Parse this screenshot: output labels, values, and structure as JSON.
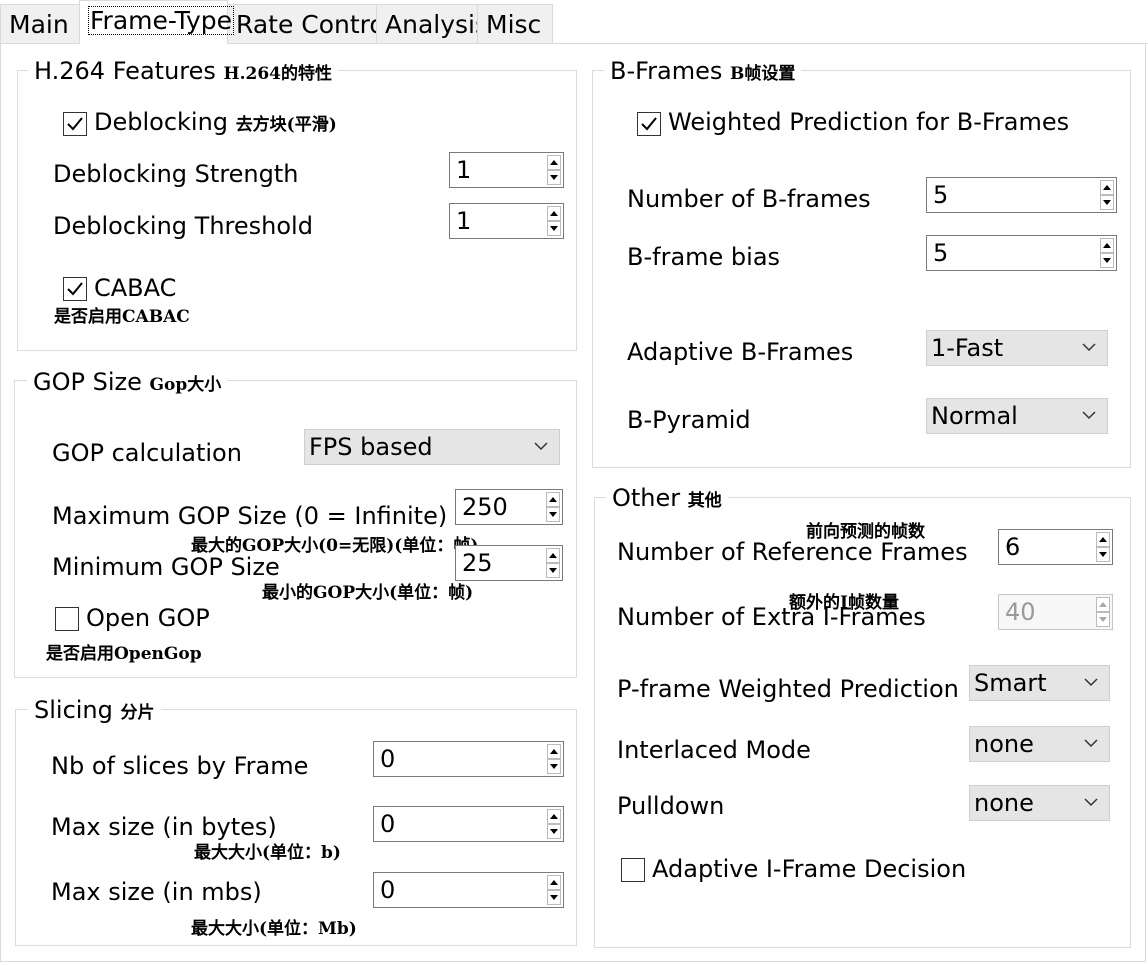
{
  "tabs": [
    {
      "label": "Main"
    },
    {
      "label": "Frame-Type"
    },
    {
      "label": "Rate Control"
    },
    {
      "label": "Analysis"
    },
    {
      "label": "Misc"
    }
  ],
  "h264": {
    "title": "H.264 Features",
    "title_cn": "H.264的特性",
    "deblocking_label": "Deblocking",
    "deblocking_cn": "去方块(平滑)",
    "deblocking_checked": true,
    "strength_label": "Deblocking Strength",
    "strength_value": "1",
    "threshold_label": "Deblocking Threshold",
    "threshold_value": "1",
    "cabac_label": "CABAC",
    "cabac_cn": "是否启用CABAC",
    "cabac_checked": true
  },
  "gop": {
    "title": "GOP Size",
    "title_cn": "Gop大小",
    "calc_label": "GOP calculation",
    "calc_value": "FPS based",
    "max_label": "Maximum GOP Size (0 = Infinite)",
    "max_cn": "最大的GOP大小(0=无限)(单位：帧)",
    "max_value": "250",
    "min_label": "Minimum GOP Size",
    "min_cn": "最小的GOP大小(单位：帧)",
    "min_value": "25",
    "open_label": "Open GOP",
    "open_cn": "是否启用OpenGop",
    "open_checked": false
  },
  "slicing": {
    "title": "Slicing",
    "title_cn": "分片",
    "nb_label": "Nb of slices by Frame",
    "nb_value": "0",
    "bytes_label": "Max size (in bytes)",
    "bytes_cn": "最大大小(单位：b)",
    "bytes_value": "0",
    "mbs_label": "Max size (in mbs)",
    "mbs_cn": "最大大小(单位：Mb)",
    "mbs_value": "0"
  },
  "bframes": {
    "title": "B-Frames",
    "title_cn": "B帧设置",
    "weighted_label": "Weighted Prediction for B-Frames",
    "weighted_checked": true,
    "num_label": "Number of B-frames",
    "num_value": "5",
    "bias_label": "B-frame bias",
    "bias_value": "5",
    "adaptive_label": "Adaptive B-Frames",
    "adaptive_value": "1-Fast",
    "pyramid_label": "B-Pyramid",
    "pyramid_value": "Normal"
  },
  "other": {
    "title": "Other",
    "title_cn": "其他",
    "ref_label": "Number of Reference Frames",
    "ref_cn": "前向预测的帧数",
    "ref_value": "6",
    "extra_label": "Number of Extra I-Frames",
    "extra_cn": "额外的I帧数量",
    "extra_value": "40",
    "pweighted_label": "P-frame Weighted Prediction",
    "pweighted_value": "Smart",
    "interlaced_label": "Interlaced Mode",
    "interlaced_value": "none",
    "pulldown_label": "Pulldown",
    "pulldown_value": "none",
    "adaptive_i_label": "Adaptive I-Frame Decision",
    "adaptive_i_checked": false
  }
}
